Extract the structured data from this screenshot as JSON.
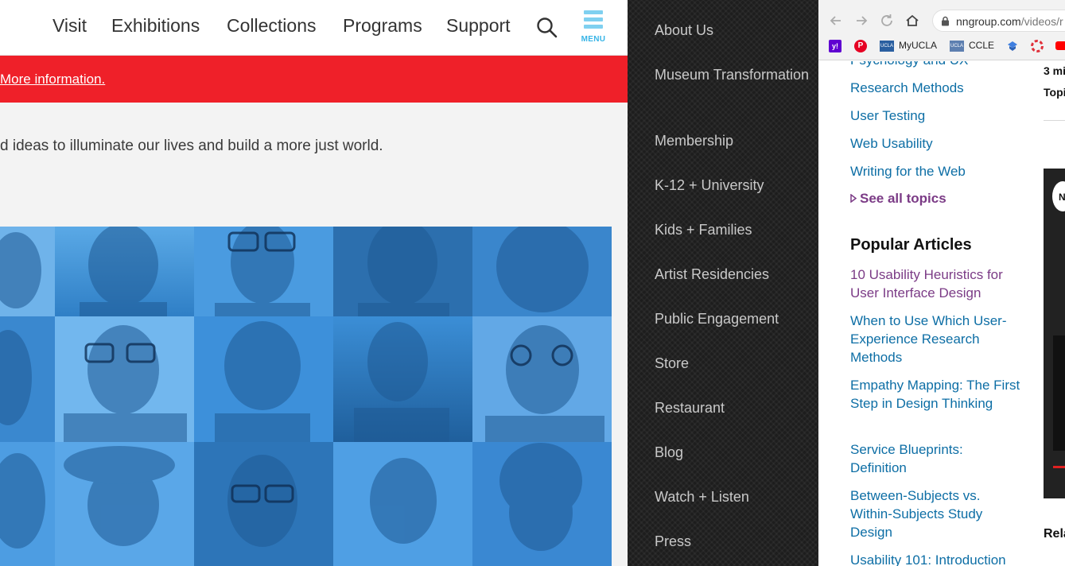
{
  "museum": {
    "nav": [
      "Visit",
      "Exhibitions",
      "Collections",
      "Programs",
      "Support"
    ],
    "menu_label": "MENU",
    "alert_link": "More information.",
    "mission": "d ideas to illuminate our lives and build a more just world.",
    "colors": {
      "alert": "#ef2029",
      "hero": "#3d92d8",
      "menu_icon": "#7fd0f0"
    }
  },
  "side_menu": {
    "items": [
      "About Us",
      "Museum Transformation",
      "Membership",
      "K-12 + University",
      "Kids + Families",
      "Artist Residencies",
      "Public Engagement",
      "Store",
      "Restaurant",
      "Blog",
      "Watch + Listen",
      "Press"
    ]
  },
  "browser": {
    "url": "nngroup.com",
    "url_path": "/videos/r",
    "bookmarks": {
      "myucla": "MyUCLA",
      "ccle": "CCLE"
    },
    "topics_cut": "Psychology and UX",
    "topics": [
      "Research Methods",
      "User Testing",
      "Web Usability",
      "Writing for the Web"
    ],
    "see_all": "See all topics",
    "popular_heading": "Popular Articles",
    "popular": [
      "10 Usability Heuristics for User Interface Design",
      "When to Use Which User-Experience Research Methods",
      "Empathy Mapping: The First Step in Design Thinking",
      "Service Blueprints: Definition",
      "Between-Subjects vs. Within-Subjects Study Design",
      "Usability 101: Introduction"
    ],
    "meta1": "3 mi",
    "meta2": "Topi",
    "video_badge": "N",
    "related": "Rela",
    "colors": {
      "link": "#0d6ea5",
      "visited": "#7b3b86"
    }
  }
}
